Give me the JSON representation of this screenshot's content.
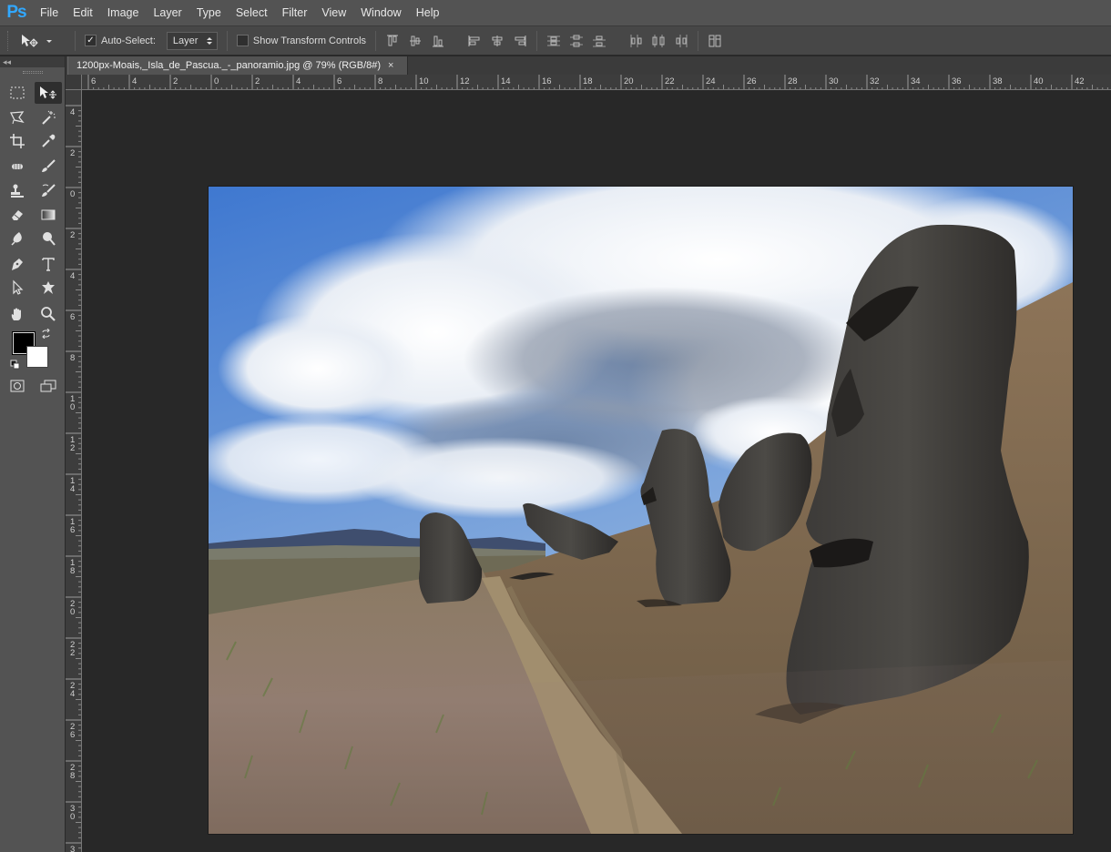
{
  "app": {
    "logo": "Ps"
  },
  "menu": [
    "File",
    "Edit",
    "Image",
    "Layer",
    "Type",
    "Select",
    "Filter",
    "View",
    "Window",
    "Help"
  ],
  "options": {
    "auto_select_label": "Auto-Select:",
    "auto_select_checked": true,
    "auto_select_target": "Layer",
    "show_transform_label": "Show Transform Controls",
    "show_transform_checked": false
  },
  "toolbar": {
    "collapse_label": "◂◂",
    "foreground_color": "#000000",
    "background_color": "#ffffff"
  },
  "document": {
    "tab_title": "1200px-Moais,_Isla_de_Pascua._-_panoramio.jpg @ 79% (RGB/8#)",
    "close_glyph": "×"
  },
  "rulers": {
    "horizontal_labels": [
      "6",
      "4",
      "2",
      "0",
      "2",
      "4",
      "6",
      "8",
      "10",
      "12",
      "14",
      "16",
      "18",
      "20",
      "22",
      "24",
      "26",
      "28",
      "30",
      "32",
      "34",
      "36",
      "38",
      "40",
      "42"
    ],
    "vertical_labels": [
      "4",
      "2",
      "0",
      "2",
      "4",
      "6",
      "8",
      "10",
      "12",
      "14",
      "16",
      "18",
      "20",
      "22",
      "24",
      "26",
      "28",
      "30",
      "3"
    ]
  },
  "icons": {
    "move_tool": "move-tool-icon",
    "marquee": "rectangular-marquee-icon",
    "lasso": "polygonal-lasso-icon",
    "magic_wand": "magic-wand-icon",
    "crop": "crop-icon",
    "eyedropper": "eyedropper-icon",
    "healing": "spot-healing-icon",
    "brush": "brush-icon",
    "stamp": "clone-stamp-icon",
    "history_brush": "history-brush-icon",
    "eraser": "eraser-icon",
    "gradient": "gradient-icon",
    "blur": "blur-icon",
    "dodge": "dodge-icon",
    "pen": "pen-icon",
    "type": "type-icon",
    "path_select": "path-selection-icon",
    "shape": "custom-shape-icon",
    "hand": "hand-icon",
    "zoom": "zoom-icon"
  }
}
